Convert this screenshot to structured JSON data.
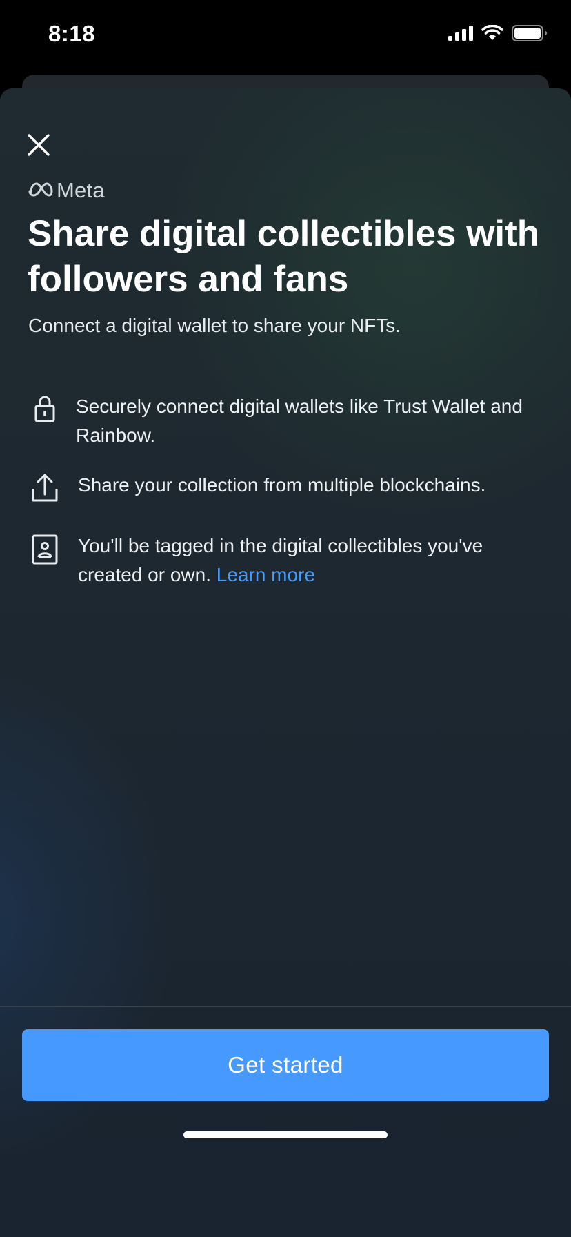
{
  "status_bar": {
    "time": "8:18",
    "icons": [
      "signal-icon",
      "wifi-icon",
      "battery-icon"
    ]
  },
  "sheet": {
    "close_icon": "close-icon",
    "brand": "Meta",
    "title": "Share digital collectibles with followers and fans",
    "subtitle": "Connect a digital wallet to share your NFTs.",
    "features": [
      {
        "icon": "lock-icon",
        "text": "Securely connect digital wallets like Trust Wallet and Rainbow."
      },
      {
        "icon": "share-icon",
        "text": "Share your collection from multiple blockchains."
      },
      {
        "icon": "profile-tag-icon",
        "text": "You'll be tagged in the digital collectibles you've created or own.",
        "link": "Learn more"
      }
    ],
    "cta_label": "Get started"
  },
  "colors": {
    "accent": "#4599ff",
    "link": "#4a9cf5",
    "background": "#1d2730"
  }
}
